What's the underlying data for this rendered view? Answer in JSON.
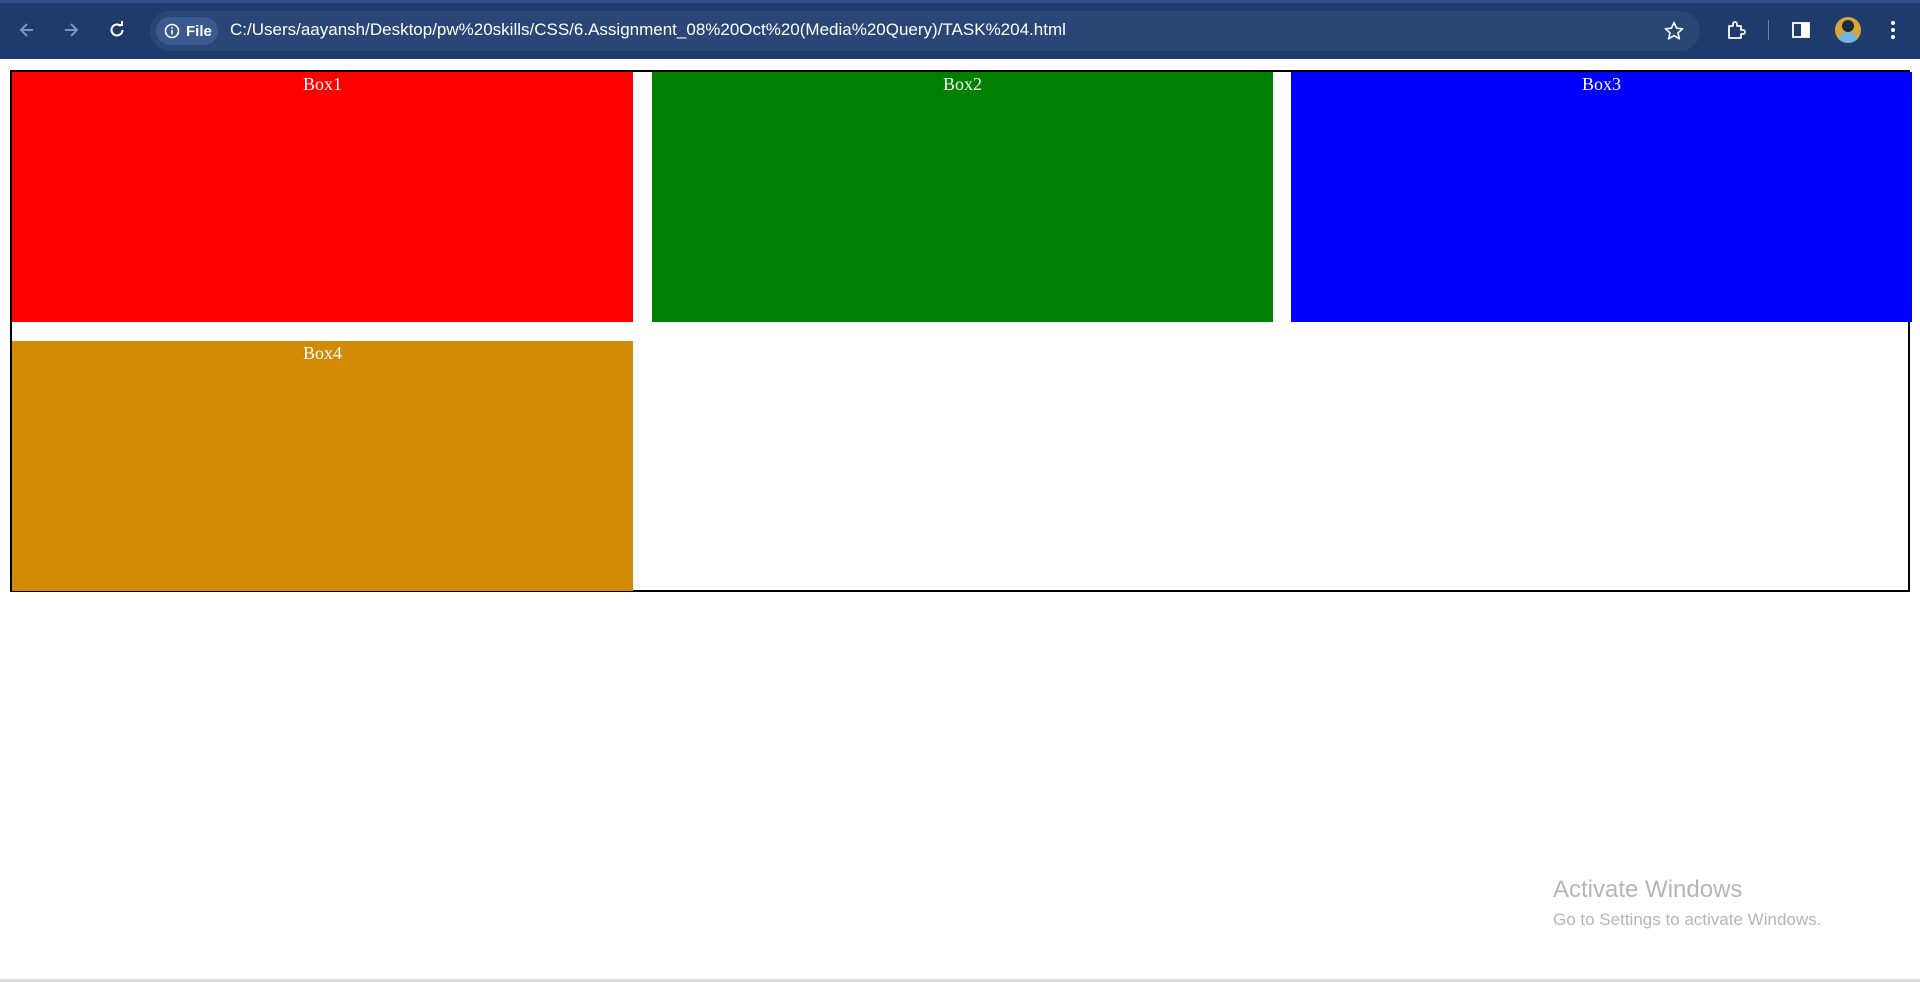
{
  "browser": {
    "site_chip_label": "File",
    "url": "C:/Users/aayansh/Desktop/pw%20skills/CSS/6.Assignment_08%20Oct%20(Media%20Query)/TASK%204.html",
    "icons": [
      "back-arrow-icon",
      "forward-arrow-icon",
      "reload-icon",
      "info-icon",
      "star-icon",
      "extensions-icon",
      "side-panel-icon",
      "avatar",
      "more-vert-icon"
    ]
  },
  "page": {
    "boxes": [
      {
        "label": "Box1",
        "color": "#ff0000"
      },
      {
        "label": "Box2",
        "color": "#008000"
      },
      {
        "label": "Box3",
        "color": "#0000ff"
      },
      {
        "label": "Box4",
        "color": "#d38b06"
      }
    ]
  },
  "watermark": {
    "title": "Activate Windows",
    "subtitle": "Go to Settings to activate Windows."
  }
}
